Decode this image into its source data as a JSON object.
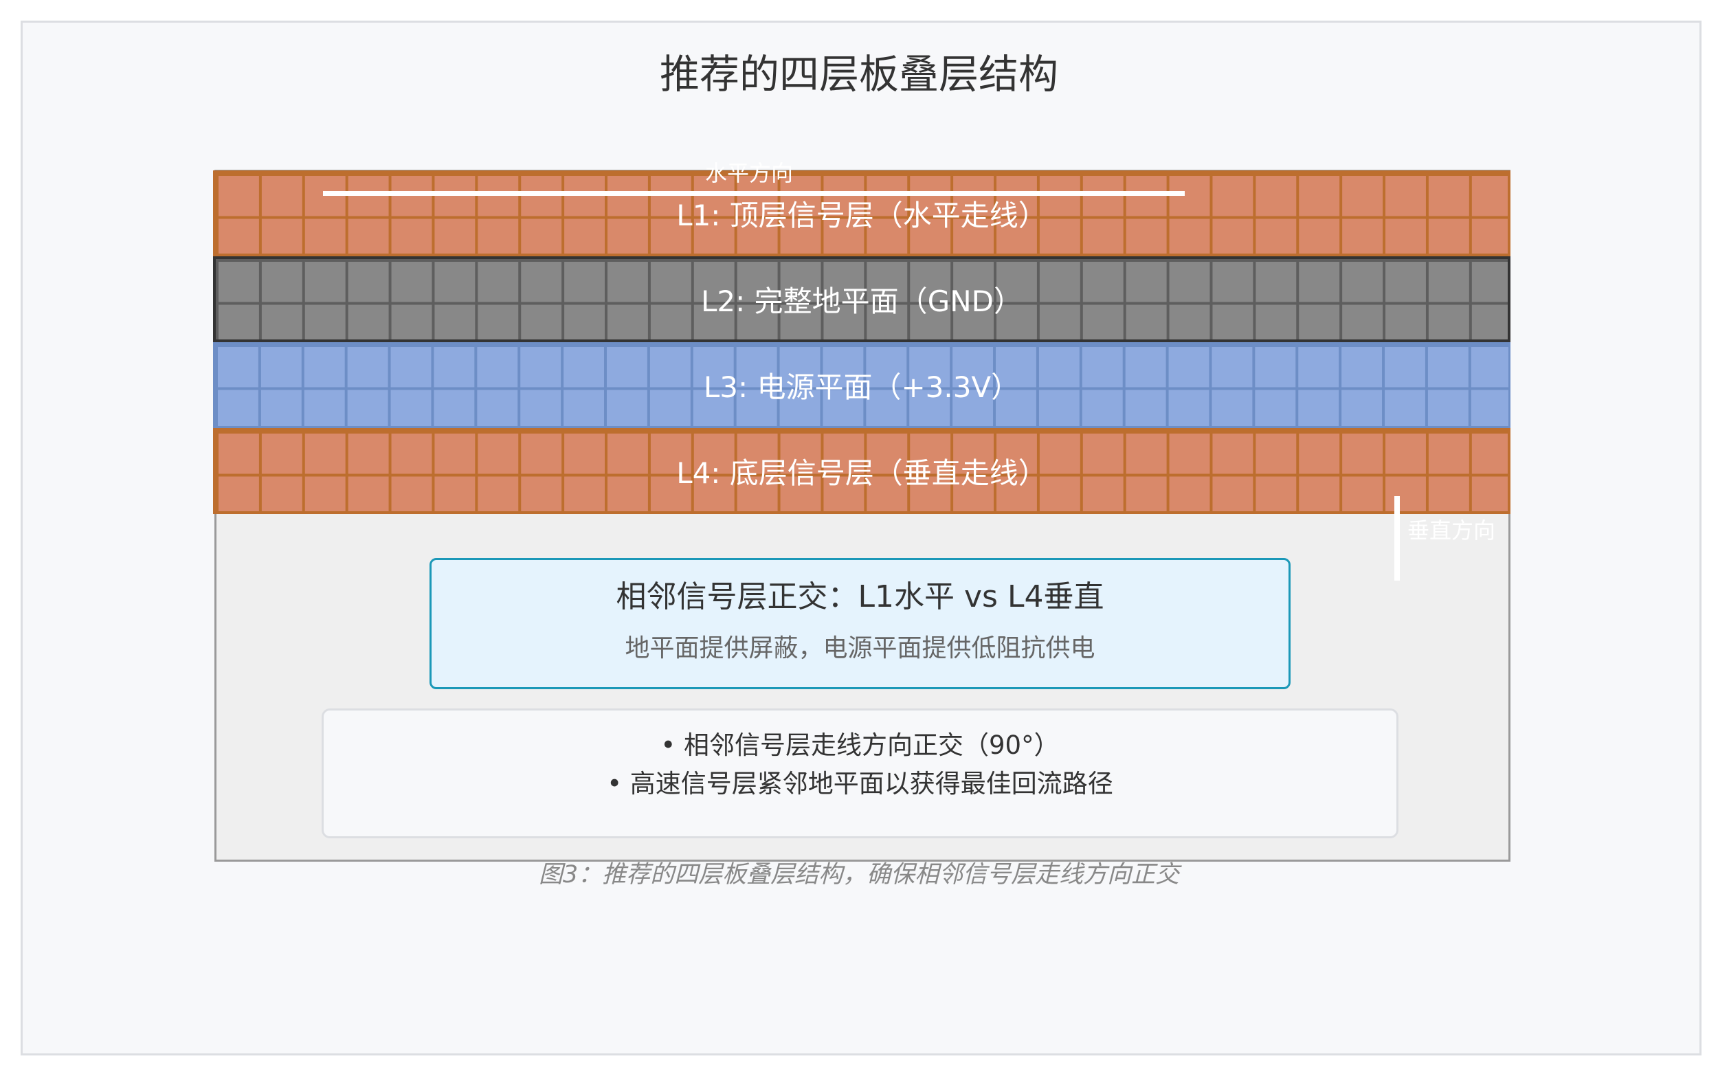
{
  "title": "推荐的四层板叠层结构",
  "layers": [
    {
      "label": "L1: 顶层信号层（水平走线）",
      "color": "#d9896a"
    },
    {
      "label": "L2: 完整地平面（GND）",
      "color": "#888888"
    },
    {
      "label": "L3: 电源平面（+3.3V）",
      "color": "#8eaadf"
    },
    {
      "label": "L4: 底层信号层（垂直走线）",
      "color": "#d9896a"
    }
  ],
  "direction": {
    "horizontal_label": "水平方向",
    "vertical_label": "垂直方向"
  },
  "callout": {
    "title": "相邻信号层正交：L1水平 vs L4垂直",
    "subtitle": "地平面提供屏蔽，电源平面提供低阻抗供电"
  },
  "notes": [
    "• 相邻信号层走线方向正交（90°）",
    "• 高速信号层紧邻地平面以获得最佳回流路径"
  ],
  "caption": "图3：推荐的四层板叠层结构，确保相邻信号层走线方向正交"
}
